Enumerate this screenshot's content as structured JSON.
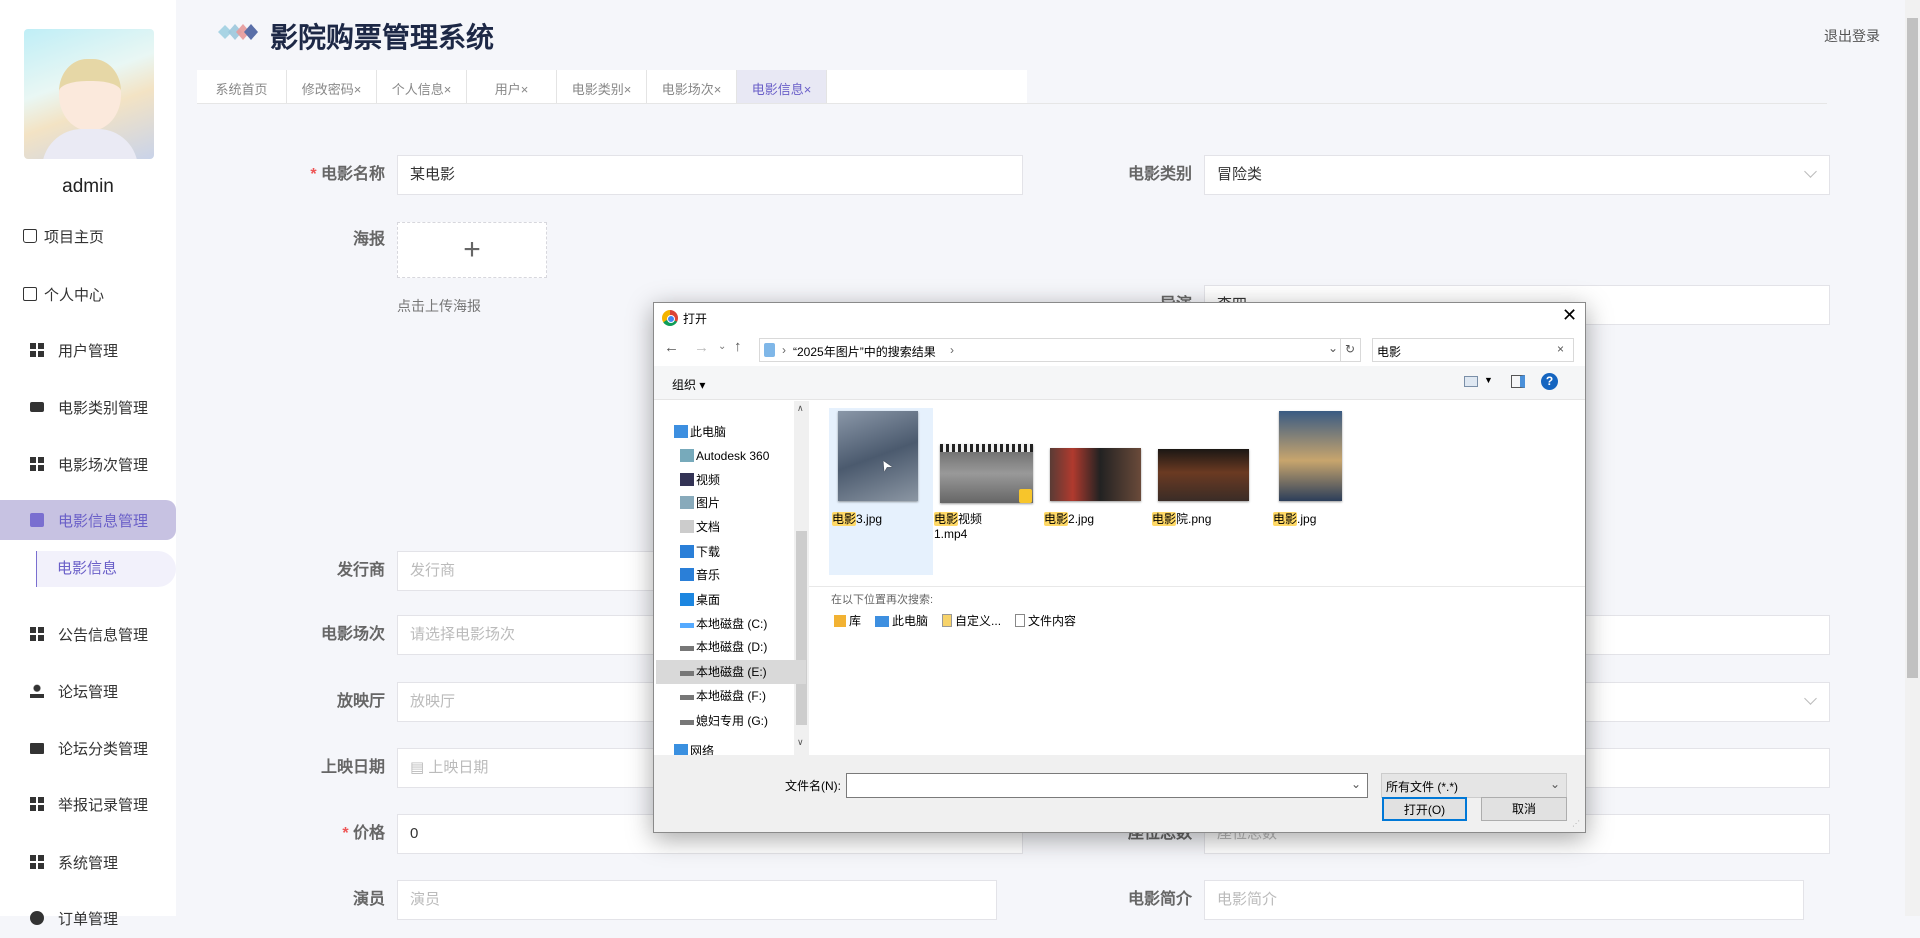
{
  "app": {
    "title": "影院购票管理系统",
    "logout": "退出登录",
    "username": "admin"
  },
  "sidebar": {
    "items": [
      {
        "label": "项目主页",
        "icon": "home-icon"
      },
      {
        "label": "个人中心",
        "icon": "card-icon"
      },
      {
        "label": "用户管理",
        "icon": "grid-icon"
      },
      {
        "label": "电影类别管理",
        "icon": "briefcase-icon"
      },
      {
        "label": "电影场次管理",
        "icon": "grid-icon"
      },
      {
        "label": "电影信息管理",
        "icon": "clipboard-icon"
      },
      {
        "label": "公告信息管理",
        "icon": "grid-icon"
      },
      {
        "label": "论坛管理",
        "icon": "user-icon"
      },
      {
        "label": "论坛分类管理",
        "icon": "chat-icon"
      },
      {
        "label": "举报记录管理",
        "icon": "grid-icon"
      },
      {
        "label": "系统管理",
        "icon": "grid-icon"
      },
      {
        "label": "订单管理",
        "icon": "order-icon"
      }
    ],
    "sub_item": "电影信息"
  },
  "tabs": [
    {
      "label": "系统首页"
    },
    {
      "label": "修改密码×"
    },
    {
      "label": "个人信息×"
    },
    {
      "label": "用户×"
    },
    {
      "label": "电影类别×"
    },
    {
      "label": "电影场次×"
    },
    {
      "label": "电影信息×"
    }
  ],
  "form": {
    "name": {
      "label": "电影名称",
      "value": "某电影"
    },
    "category": {
      "label": "电影类别",
      "value": "冒险类"
    },
    "poster": {
      "label": "海报",
      "hint": "点击上传海报"
    },
    "director": {
      "label": "导演",
      "value": "李四"
    },
    "publisher": {
      "label": "发行商",
      "placeholder": "发行商"
    },
    "session": {
      "label": "电影场次",
      "placeholder": "请选择电影场次"
    },
    "hall": {
      "label": "放映厅",
      "placeholder": "放映厅"
    },
    "date": {
      "label": "上映日期",
      "placeholder": "上映日期"
    },
    "price": {
      "label": "价格",
      "value": "0"
    },
    "seats": {
      "label": "座位总数",
      "placeholder": "座位总数"
    },
    "actors": {
      "label": "演员",
      "placeholder": "演员"
    },
    "intro": {
      "label": "电影简介",
      "placeholder": "电影简介"
    }
  },
  "dialog": {
    "title": "打开",
    "path": "“2025年图片”中的搜索结果",
    "search": "电影",
    "organize": "组织 ▾",
    "nav": [
      "此电脑",
      "Autodesk 360",
      "视频",
      "图片",
      "文档",
      "下载",
      "音乐",
      "桌面",
      "本地磁盘 (C:)",
      "本地磁盘 (D:)",
      "本地磁盘 (E:)",
      "本地磁盘 (F:)",
      "媳妇专用 (G:)",
      "网络"
    ],
    "files": [
      {
        "hl": "电影",
        "rest": "3.jpg"
      },
      {
        "hl": "电影",
        "rest": "视频1.mp4"
      },
      {
        "hl": "电影",
        "rest": "2.jpg"
      },
      {
        "hl": "电影",
        "rest": "院.png"
      },
      {
        "hl": "电影",
        "rest": ".jpg"
      }
    ],
    "search_again": "在以下位置再次搜索:",
    "locations": [
      "库",
      "此电脑",
      "自定义...",
      "文件内容"
    ],
    "filename_label": "文件名(N):",
    "filename": "",
    "filter": "所有文件 (*.*)",
    "open": "打开(O)",
    "cancel": "取消"
  }
}
